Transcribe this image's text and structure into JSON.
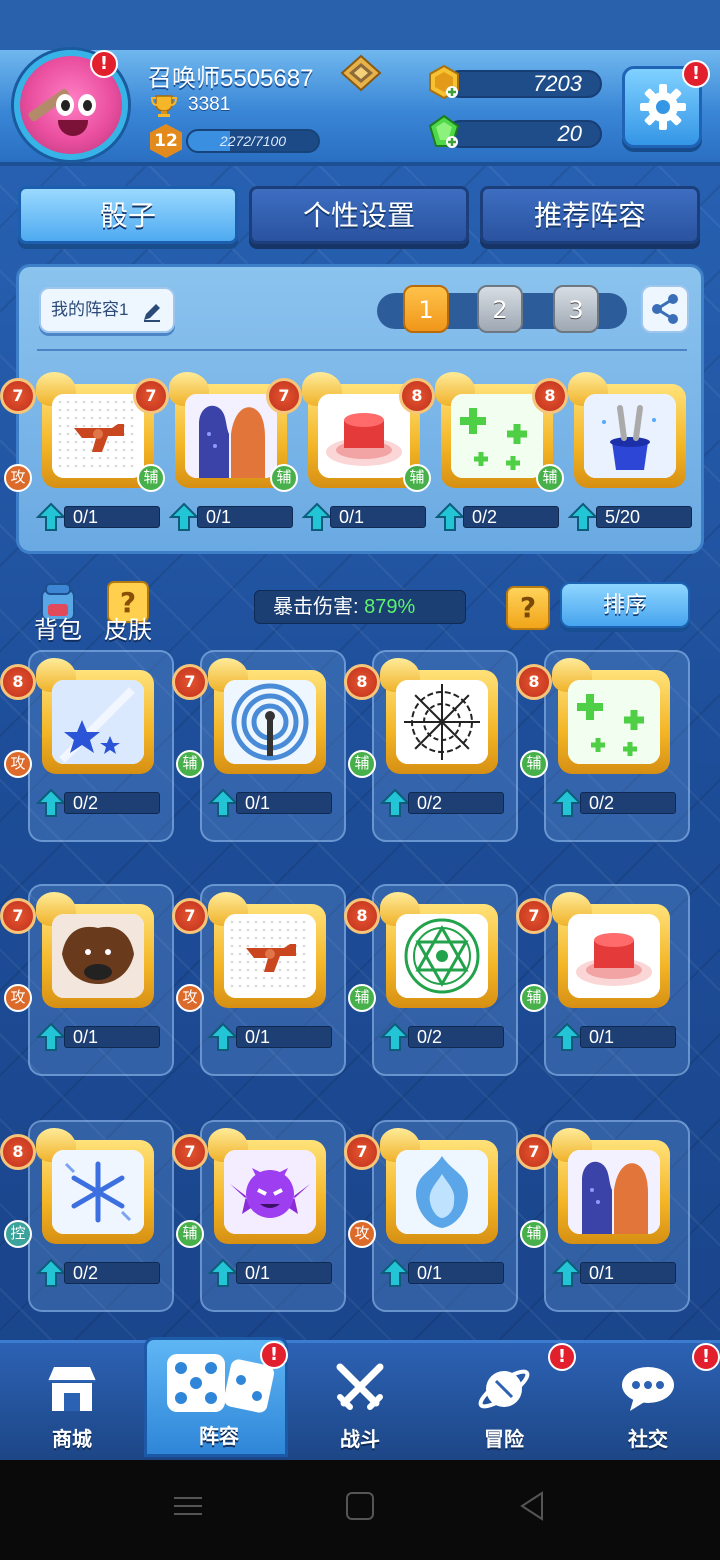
{
  "header": {
    "username": "召唤师5505687",
    "trophies": "3381",
    "level": "12",
    "xp_text": "2272/7100",
    "xp_progress": 0.32,
    "gold": "7203",
    "gems": "20",
    "alert": "!"
  },
  "tabs": [
    {
      "label": "骰子",
      "active": true
    },
    {
      "label": "个性设置",
      "active": false
    },
    {
      "label": "推荐阵容",
      "active": false
    }
  ],
  "deck": {
    "name": "我的阵容1",
    "slots": [
      "1",
      "2",
      "3"
    ],
    "active_slot": 0,
    "cards": [
      {
        "icon": "revolver-icon",
        "level": "7",
        "type": "攻",
        "progress": "0/1"
      },
      {
        "icon": "figures-icon",
        "level": "7",
        "type": "辅",
        "progress": "0/1"
      },
      {
        "icon": "red-drum-icon",
        "level": "7",
        "type": "辅",
        "progress": "0/1"
      },
      {
        "icon": "green-plus-icon",
        "level": "8",
        "type": "辅",
        "progress": "0/2"
      },
      {
        "icon": "magic-hat-icon",
        "level": "8",
        "type": "辅",
        "progress": "5/20"
      }
    ]
  },
  "controls": {
    "backpack_label": "背包",
    "skin_label": "皮肤",
    "crit_label": "暴击伤害:",
    "crit_value": "879%",
    "help": "?",
    "sort_label": "排序"
  },
  "collection": [
    {
      "icon": "stars-icon",
      "level": "8",
      "type": "攻",
      "progress": "0/2"
    },
    {
      "icon": "signal-icon",
      "level": "7",
      "type": "辅",
      "progress": "0/1"
    },
    {
      "icon": "web-icon",
      "level": "8",
      "type": "辅",
      "progress": "0/2"
    },
    {
      "icon": "green-plus-icon",
      "level": "8",
      "type": "辅",
      "progress": "0/2"
    },
    {
      "icon": "beast-icon",
      "level": "7",
      "type": "攻",
      "progress": "0/1"
    },
    {
      "icon": "revolver-icon",
      "level": "7",
      "type": "攻",
      "progress": "0/1"
    },
    {
      "icon": "magic-circle-icon",
      "level": "8",
      "type": "辅",
      "progress": "0/2"
    },
    {
      "icon": "red-drum-icon",
      "level": "7",
      "type": "辅",
      "progress": "0/1"
    },
    {
      "icon": "snowflake-icon",
      "level": "8",
      "type": "控",
      "progress": "0/2"
    },
    {
      "icon": "demon-icon",
      "level": "7",
      "type": "辅",
      "progress": "0/1"
    },
    {
      "icon": "ice-flame-icon",
      "level": "7",
      "type": "攻",
      "progress": "0/1"
    },
    {
      "icon": "figures-icon",
      "level": "7",
      "type": "辅",
      "progress": "0/1"
    }
  ],
  "nav": [
    {
      "label": "商城",
      "icon": "shop-icon",
      "alert": false
    },
    {
      "label": "阵容",
      "icon": "dice-icon",
      "alert": true,
      "active": true
    },
    {
      "label": "战斗",
      "icon": "crossed-swords-icon",
      "alert": false
    },
    {
      "label": "冒险",
      "icon": "planet-icon",
      "alert": true
    },
    {
      "label": "社交",
      "icon": "chat-icon",
      "alert": true
    }
  ]
}
